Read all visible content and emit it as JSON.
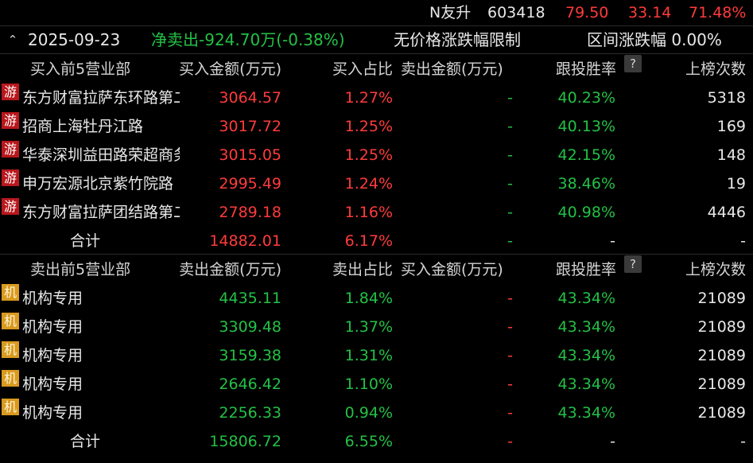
{
  "header": {
    "stock_name": "N友升",
    "stock_code": "603418",
    "price": "79.50",
    "change": "33.14",
    "change_pct": "71.48%",
    "date": "2025-09-23",
    "net_label": "净卖出-924.70万(-0.38%)",
    "limit_text": "无价格涨跌幅限制",
    "range_text": "区间涨跌幅 0.00%"
  },
  "buy_section": {
    "headers": [
      "买入前5营业部",
      "买入金额(万元)",
      "买入占比",
      "卖出金额(万元)",
      "跟投胜率",
      "?",
      "上榜次数"
    ],
    "rows": [
      {
        "badge": "游",
        "name": "东方财富拉萨东环路第二证券营业部",
        "amount": "3064.57",
        "pct": "1.27%",
        "other": "-",
        "win": "40.23%",
        "count": "5318"
      },
      {
        "badge": "游",
        "name": "招商上海牡丹江路",
        "amount": "3017.72",
        "pct": "1.25%",
        "other": "-",
        "win": "40.13%",
        "count": "169"
      },
      {
        "badge": "游",
        "name": "华泰深圳益田路荣超商务中心",
        "amount": "3015.05",
        "pct": "1.25%",
        "other": "-",
        "win": "42.15%",
        "count": "148"
      },
      {
        "badge": "游",
        "name": "申万宏源北京紫竹院路",
        "amount": "2995.49",
        "pct": "1.24%",
        "other": "-",
        "win": "38.46%",
        "count": "19"
      },
      {
        "badge": "游",
        "name": "东方财富拉萨团结路第二证券营业部",
        "amount": "2789.18",
        "pct": "1.16%",
        "other": "-",
        "win": "40.98%",
        "count": "4446"
      }
    ],
    "total": {
      "label": "合计",
      "amount": "14882.01",
      "pct": "6.17%",
      "other": "-",
      "win": "-",
      "count": "-"
    }
  },
  "sell_section": {
    "headers": [
      "卖出前5营业部",
      "卖出金额(万元)",
      "卖出占比",
      "买入金额(万元)",
      "跟投胜率",
      "?",
      "上榜次数"
    ],
    "rows": [
      {
        "badge": "机",
        "name": "机构专用",
        "amount": "4435.11",
        "pct": "1.84%",
        "other": "-",
        "win": "43.34%",
        "count": "21089"
      },
      {
        "badge": "机",
        "name": "机构专用",
        "amount": "3309.48",
        "pct": "1.37%",
        "other": "-",
        "win": "43.34%",
        "count": "21089"
      },
      {
        "badge": "机",
        "name": "机构专用",
        "amount": "3159.38",
        "pct": "1.31%",
        "other": "-",
        "win": "43.34%",
        "count": "21089"
      },
      {
        "badge": "机",
        "name": "机构专用",
        "amount": "2646.42",
        "pct": "1.10%",
        "other": "-",
        "win": "43.34%",
        "count": "21089"
      },
      {
        "badge": "机",
        "name": "机构专用",
        "amount": "2256.33",
        "pct": "0.94%",
        "other": "-",
        "win": "43.34%",
        "count": "21089"
      }
    ],
    "total": {
      "label": "合计",
      "amount": "15806.72",
      "pct": "6.55%",
      "other": "-",
      "win": "-",
      "count": "-"
    }
  },
  "colors": {
    "up": "#ff3b3b",
    "down": "#23c145",
    "badge_you": "#b8171c",
    "badge_ji": "#d99a1e",
    "background": "#000000"
  }
}
